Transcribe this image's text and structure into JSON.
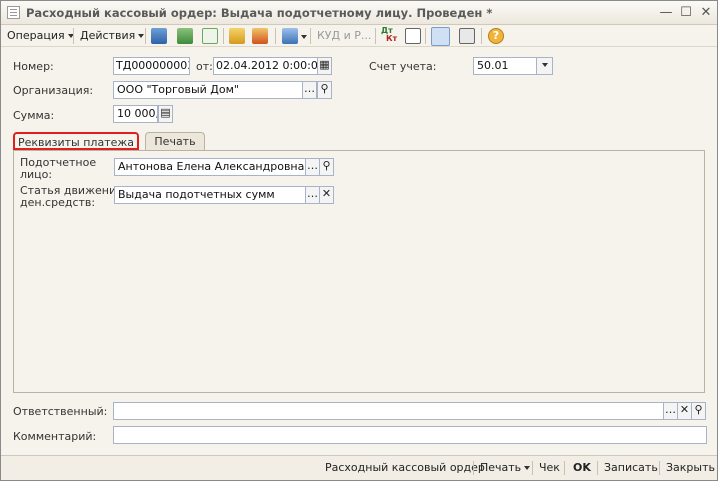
{
  "window": {
    "title": "Расходный кассовый ордер: Выдача подотчетному лицу. Проведен *"
  },
  "toolbar": {
    "operation": "Операция",
    "actions": "Действия",
    "kud": "КУД и Р...",
    "dt_kt_top": "Дт",
    "dt_kt_bottom": "Кт",
    "help": "?"
  },
  "form": {
    "number_label": "Номер:",
    "number_value": "ТД000000003",
    "from_label": "от:",
    "date_value": "02.04.2012  0:00:00",
    "account_label": "Счет учета:",
    "account_value": "50.01",
    "org_label": "Организация:",
    "org_value": "ООО \"Торговый Дом\"",
    "sum_label": "Сумма:",
    "sum_value": "10 000,00"
  },
  "tabs": [
    {
      "label": "Реквизиты платежа",
      "active": true
    },
    {
      "label": "Печать",
      "active": false
    }
  ],
  "payment": {
    "person_label_1": "Подотчетное",
    "person_label_2": "лицо:",
    "person_value": "Антонова Елена Александровна",
    "article_label_1": "Статья движения",
    "article_label_2": "ден.средств:",
    "article_value": "Выдача подотчетных сумм"
  },
  "footer_fields": {
    "responsible_label": "Ответственный:",
    "responsible_value": "",
    "comment_label": "Комментарий:",
    "comment_value": ""
  },
  "bottom": {
    "rko": "Расходный кассовый ордер",
    "print": "Печать",
    "check": "Чек",
    "ok": "OK",
    "save": "Записать",
    "close": "Закрыть"
  },
  "colors": {
    "accent_tab_border": "#e0201f",
    "field_border": "#a8b4c6",
    "background": "#f6f3ec"
  }
}
